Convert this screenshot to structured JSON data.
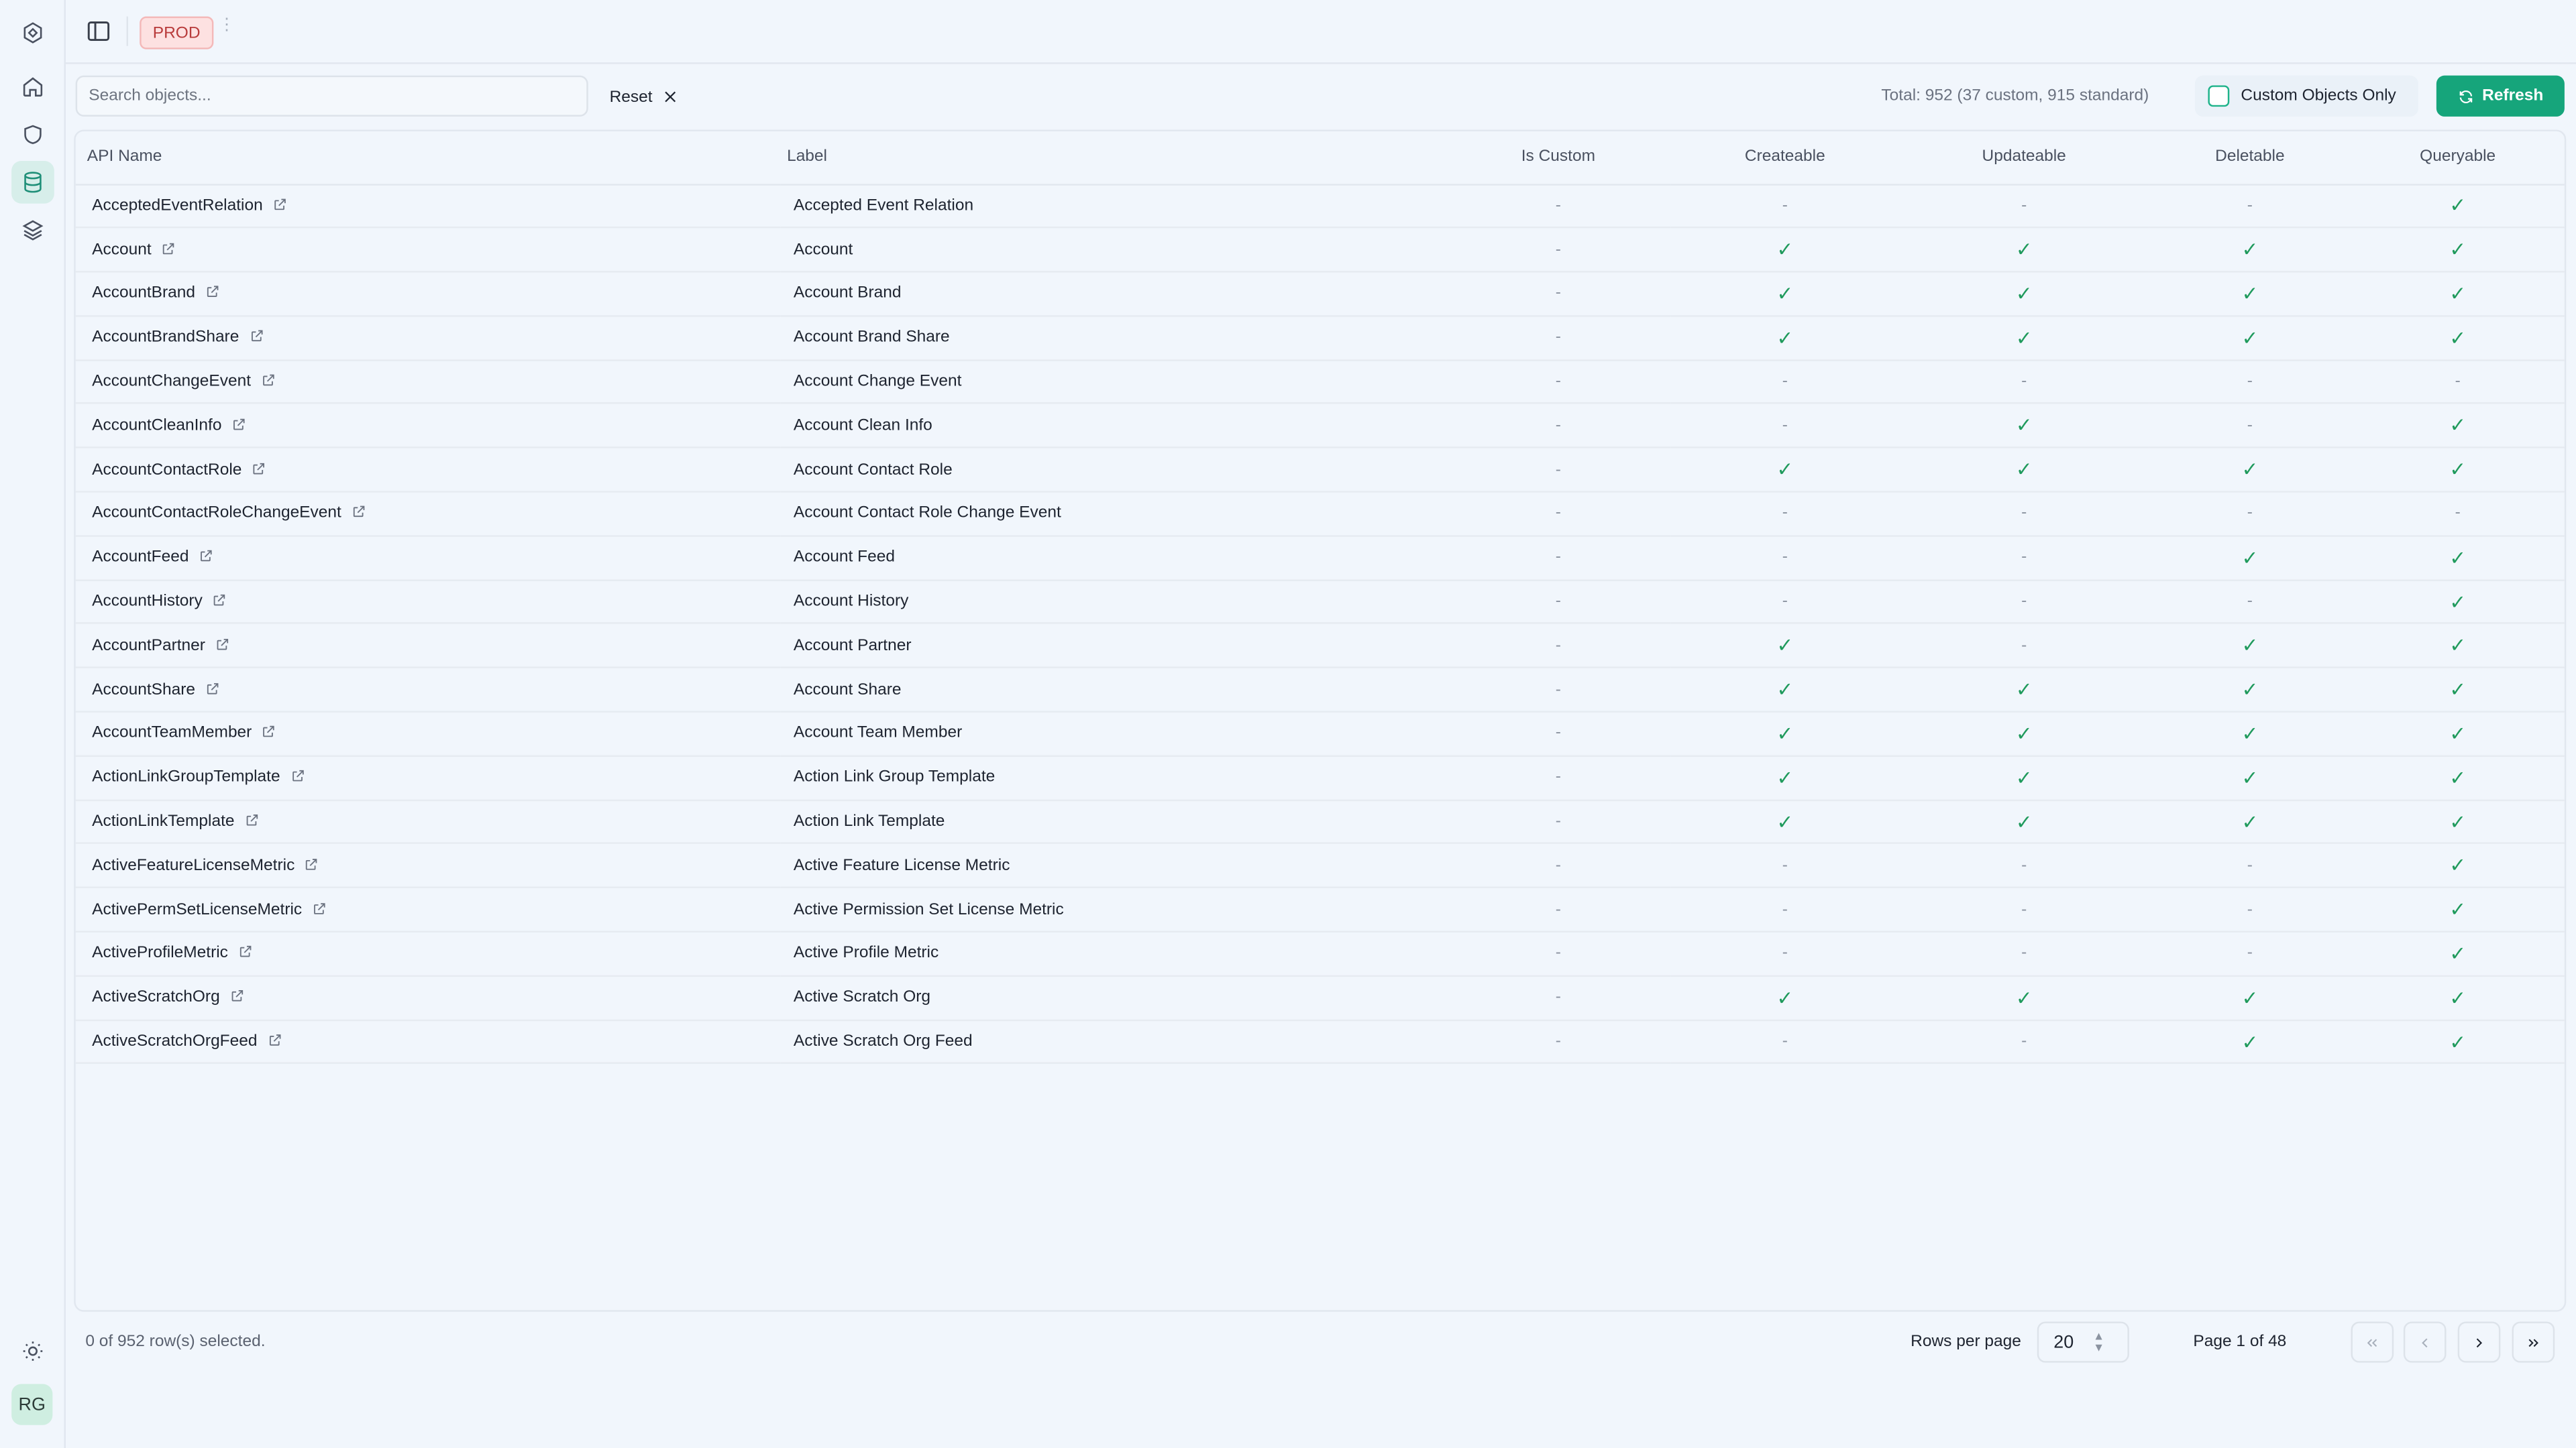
{
  "sidebar": {
    "items": [
      {
        "name": "home-icon",
        "label": "Home"
      },
      {
        "name": "shield-icon",
        "label": "Security"
      },
      {
        "name": "database-icon",
        "label": "Objects"
      },
      {
        "name": "layers-icon",
        "label": "Layers"
      }
    ],
    "avatar": "RG"
  },
  "topbar": {
    "env_badge": "PROD",
    "separator": "⋮"
  },
  "toolbar": {
    "search_placeholder": "Search objects...",
    "reset_label": "Reset",
    "total_text": "Total: 952 (37 custom, 915 standard)",
    "custom_only_label": "Custom Objects Only",
    "refresh_label": "Refresh"
  },
  "table": {
    "columns": [
      "API Name",
      "Label",
      "Is Custom",
      "Createable",
      "Updateable",
      "Deletable",
      "Queryable"
    ],
    "rows": [
      {
        "api": "AcceptedEventRelation",
        "label": "Accepted Event Relation",
        "custom": false,
        "create": false,
        "update": false,
        "delete": false,
        "query": true
      },
      {
        "api": "Account",
        "label": "Account",
        "custom": false,
        "create": true,
        "update": true,
        "delete": true,
        "query": true
      },
      {
        "api": "AccountBrand",
        "label": "Account Brand",
        "custom": false,
        "create": true,
        "update": true,
        "delete": true,
        "query": true
      },
      {
        "api": "AccountBrandShare",
        "label": "Account Brand Share",
        "custom": false,
        "create": true,
        "update": true,
        "delete": true,
        "query": true
      },
      {
        "api": "AccountChangeEvent",
        "label": "Account Change Event",
        "custom": false,
        "create": false,
        "update": false,
        "delete": false,
        "query": false
      },
      {
        "api": "AccountCleanInfo",
        "label": "Account Clean Info",
        "custom": false,
        "create": false,
        "update": true,
        "delete": false,
        "query": true
      },
      {
        "api": "AccountContactRole",
        "label": "Account Contact Role",
        "custom": false,
        "create": true,
        "update": true,
        "delete": true,
        "query": true
      },
      {
        "api": "AccountContactRoleChangeEvent",
        "label": "Account Contact Role Change Event",
        "custom": false,
        "create": false,
        "update": false,
        "delete": false,
        "query": false
      },
      {
        "api": "AccountFeed",
        "label": "Account Feed",
        "custom": false,
        "create": false,
        "update": false,
        "delete": true,
        "query": true
      },
      {
        "api": "AccountHistory",
        "label": "Account History",
        "custom": false,
        "create": false,
        "update": false,
        "delete": false,
        "query": true
      },
      {
        "api": "AccountPartner",
        "label": "Account Partner",
        "custom": false,
        "create": true,
        "update": false,
        "delete": true,
        "query": true
      },
      {
        "api": "AccountShare",
        "label": "Account Share",
        "custom": false,
        "create": true,
        "update": true,
        "delete": true,
        "query": true
      },
      {
        "api": "AccountTeamMember",
        "label": "Account Team Member",
        "custom": false,
        "create": true,
        "update": true,
        "delete": true,
        "query": true
      },
      {
        "api": "ActionLinkGroupTemplate",
        "label": "Action Link Group Template",
        "custom": false,
        "create": true,
        "update": true,
        "delete": true,
        "query": true
      },
      {
        "api": "ActionLinkTemplate",
        "label": "Action Link Template",
        "custom": false,
        "create": true,
        "update": true,
        "delete": true,
        "query": true
      },
      {
        "api": "ActiveFeatureLicenseMetric",
        "label": "Active Feature License Metric",
        "custom": false,
        "create": false,
        "update": false,
        "delete": false,
        "query": true
      },
      {
        "api": "ActivePermSetLicenseMetric",
        "label": "Active Permission Set License Metric",
        "custom": false,
        "create": false,
        "update": false,
        "delete": false,
        "query": true
      },
      {
        "api": "ActiveProfileMetric",
        "label": "Active Profile Metric",
        "custom": false,
        "create": false,
        "update": false,
        "delete": false,
        "query": true
      },
      {
        "api": "ActiveScratchOrg",
        "label": "Active Scratch Org",
        "custom": false,
        "create": true,
        "update": true,
        "delete": true,
        "query": true
      },
      {
        "api": "ActiveScratchOrgFeed",
        "label": "Active Scratch Org Feed",
        "custom": false,
        "create": false,
        "update": false,
        "delete": true,
        "query": true
      }
    ],
    "true_symbol": "✓",
    "false_symbol": "-"
  },
  "footer": {
    "selection_text": "0 of 952 row(s) selected.",
    "rows_per_page_label": "Rows per page",
    "rows_per_page_value": "20",
    "page_text": "Page 1 of 48"
  },
  "colors": {
    "accent": "#16a57b",
    "check": "#1f9a5c",
    "badge_bg": "#fde1e1",
    "badge_text": "#b83b3b"
  }
}
